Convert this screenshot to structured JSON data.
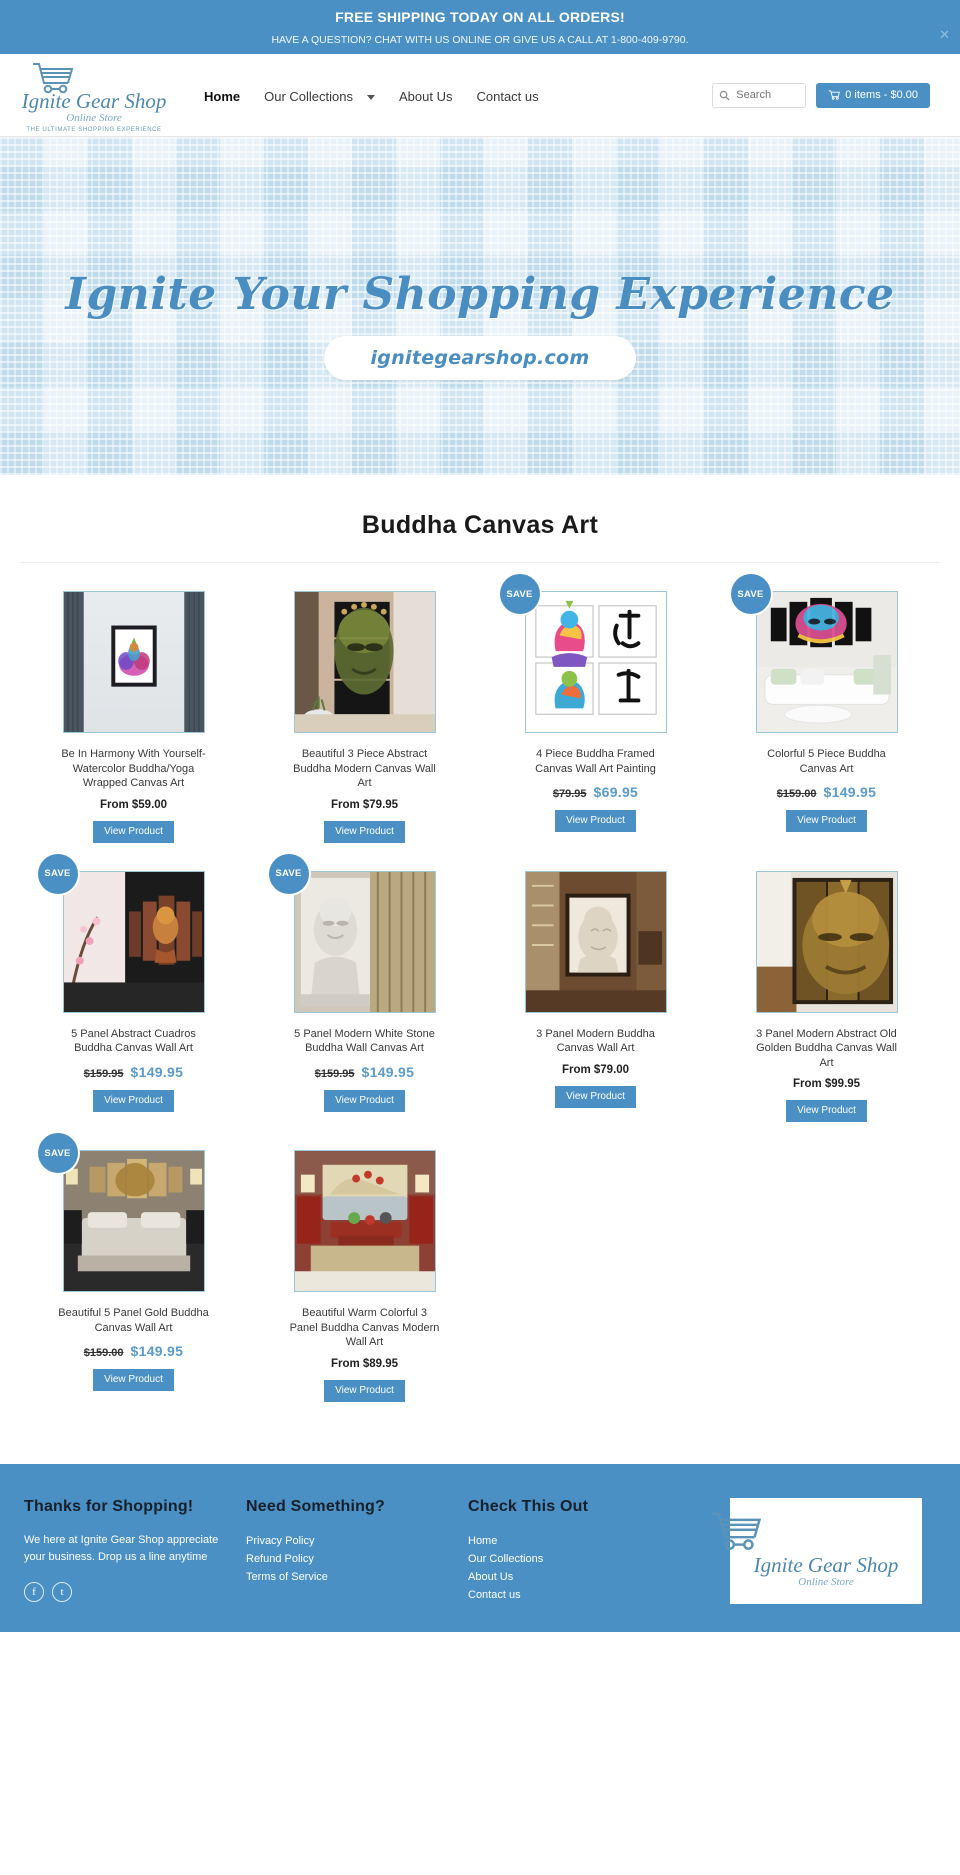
{
  "announcement": {
    "line1": "FREE SHIPPING TODAY ON ALL ORDERS!",
    "line2": "HAVE A QUESTION? CHAT WITH US ONLINE  OR GIVE US A CALL AT 1-800-409-9790.",
    "close": "✕"
  },
  "brand": {
    "name": "Ignite Gear Shop",
    "script": "Online Store",
    "tagline": "THE ULTIMATE SHOPPING EXPERIENCE"
  },
  "nav": {
    "items": [
      {
        "label": "Home",
        "active": true
      },
      {
        "label": "Our Collections",
        "active": false,
        "caret": true
      },
      {
        "label": "About Us",
        "active": false
      },
      {
        "label": "Contact us",
        "active": false
      }
    ]
  },
  "search": {
    "placeholder": "Search",
    "value": ""
  },
  "cart": {
    "label": "0 items  - $0.00"
  },
  "hero": {
    "title": "Ignite Your Shopping Experience",
    "pill": "ignitegearshop.com"
  },
  "collection": {
    "title": "Buddha Canvas Art",
    "view_product_label": "View Product",
    "save_badge_label": "SAVE",
    "products": [
      {
        "title": "Be In Harmony With Yourself-Watercolor Buddha/Yoga Wrapped Canvas Art",
        "price_from": "From $59.00",
        "was": "",
        "now": "",
        "sale": false
      },
      {
        "title": "Beautiful 3 Piece Abstract Buddha Modern Canvas Wall Art",
        "price_from": "From $79.95",
        "was": "",
        "now": "",
        "sale": false
      },
      {
        "title": "4 Piece Buddha Framed Canvas Wall Art Painting",
        "price_from": "",
        "was": "$79.95",
        "now": "$69.95",
        "sale": true
      },
      {
        "title": "Colorful 5 Piece Buddha Canvas Art",
        "price_from": "",
        "was": "$159.00",
        "now": "$149.95",
        "sale": true
      },
      {
        "title": "5 Panel Abstract   Cuadros Buddha Canvas Wall Art",
        "price_from": "",
        "was": "$159.95",
        "now": "$149.95",
        "sale": true
      },
      {
        "title": "5 Panel Modern White Stone Buddha Wall Canvas Art",
        "price_from": "",
        "was": "$159.95",
        "now": "$149.95",
        "sale": true
      },
      {
        "title": "3 Panel Modern Buddha Canvas Wall Art",
        "price_from": "From $79.00",
        "was": "",
        "now": "",
        "sale": false
      },
      {
        "title": "3 Panel Modern Abstract Old Golden Buddha Canvas Wall Art",
        "price_from": "From $99.95",
        "was": "",
        "now": "",
        "sale": false
      },
      {
        "title": "Beautiful 5 Panel Gold Buddha Canvas Wall Art",
        "price_from": "",
        "was": "$159.00",
        "now": "$149.95",
        "sale": true
      },
      {
        "title": "Beautiful Warm Colorful 3 Panel Buddha Canvas Modern Wall Art",
        "price_from": "From $89.95",
        "was": "",
        "now": "",
        "sale": false
      }
    ]
  },
  "footer": {
    "col1": {
      "head": "Thanks for Shopping!",
      "text": "We here at Ignite Gear Shop appreciate your business. Drop us a line anytime",
      "socials": [
        "f",
        "t"
      ]
    },
    "col2": {
      "head": "Need Something?",
      "links": [
        "Privacy Policy",
        "Refund Policy",
        "Terms of Service"
      ]
    },
    "col3": {
      "head": "Check This Out",
      "links": [
        "Home",
        "Our Collections",
        "About Us",
        "Contact us"
      ]
    },
    "logo": {
      "name": "Ignite Gear Shop",
      "script": "Online Store"
    }
  },
  "colors": {
    "brand_blue": "#4a90c4",
    "hero_bg": "#d7e9f3",
    "price_blue": "#5a9bcb"
  }
}
